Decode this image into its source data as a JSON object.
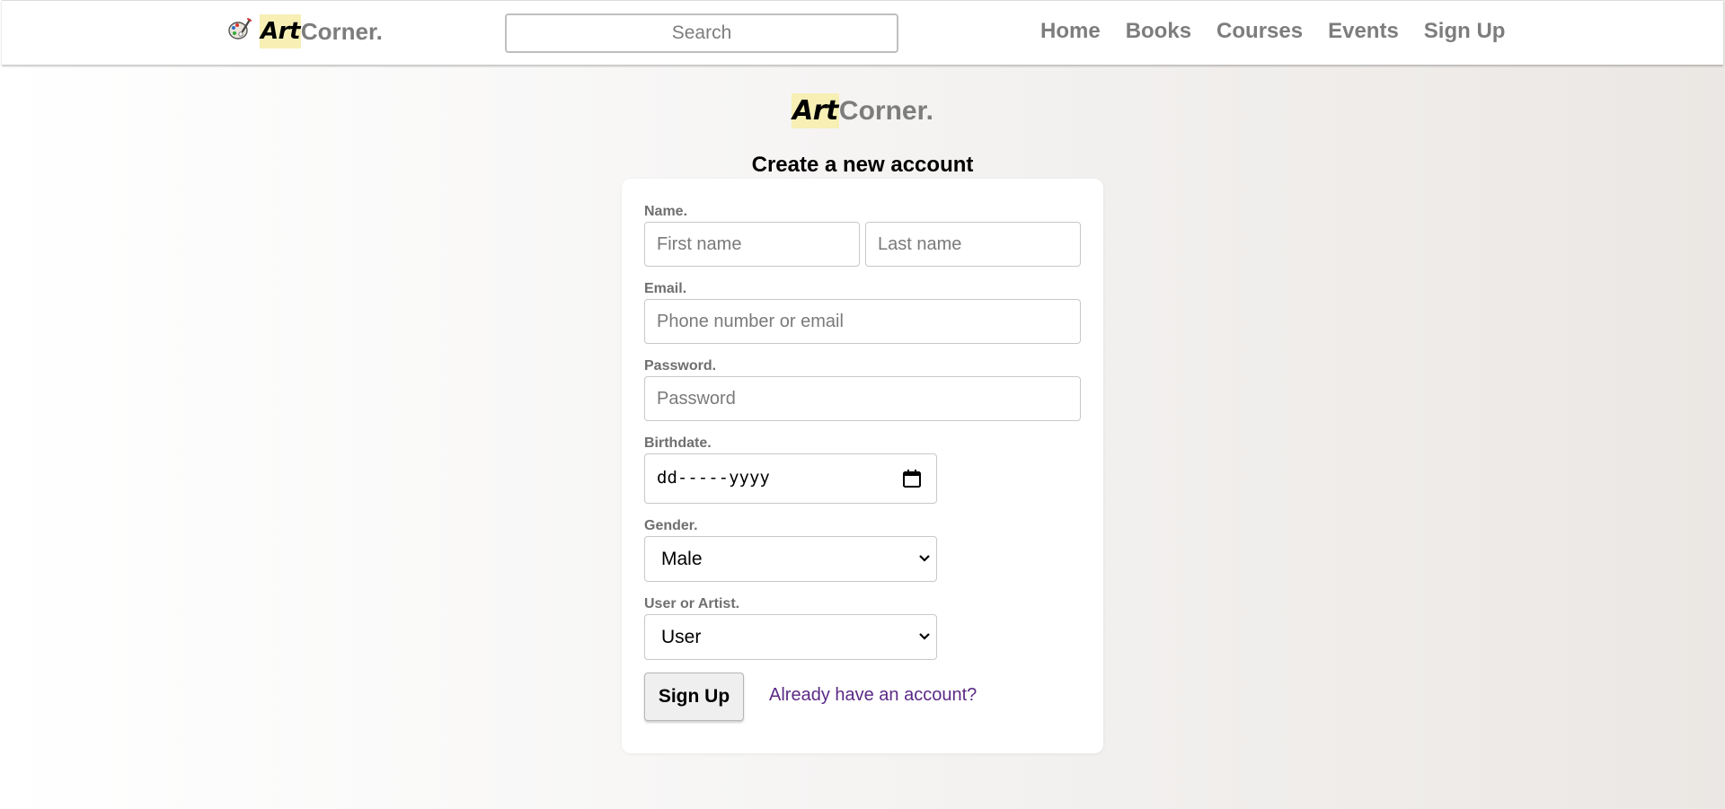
{
  "navbar": {
    "brand": {
      "highlight": "Art",
      "rest": "Corner."
    },
    "search": {
      "placeholder": "Search",
      "value": ""
    },
    "links": [
      "Home",
      "Books",
      "Courses",
      "Events",
      "Sign Up"
    ]
  },
  "hero": {
    "highlight": "Art",
    "rest": "Corner."
  },
  "form": {
    "title": "Create a new account",
    "name_label": "Name.",
    "first_name_placeholder": "First name",
    "last_name_placeholder": "Last name",
    "email_label": "Email.",
    "email_placeholder": "Phone number or email",
    "password_label": "Password.",
    "password_placeholder": "Password",
    "birthdate_label": "Birthdate.",
    "birthdate_value": "dd-----yyyy",
    "gender_label": "Gender.",
    "gender_value": "Male",
    "role_label": "User or Artist.",
    "role_value": "User",
    "submit_label": "Sign Up",
    "login_link": "Already have an account?"
  },
  "colors": {
    "highlight": "#f7efb4",
    "brand_gray": "#7d7d7d",
    "link": "#5b2a86"
  }
}
